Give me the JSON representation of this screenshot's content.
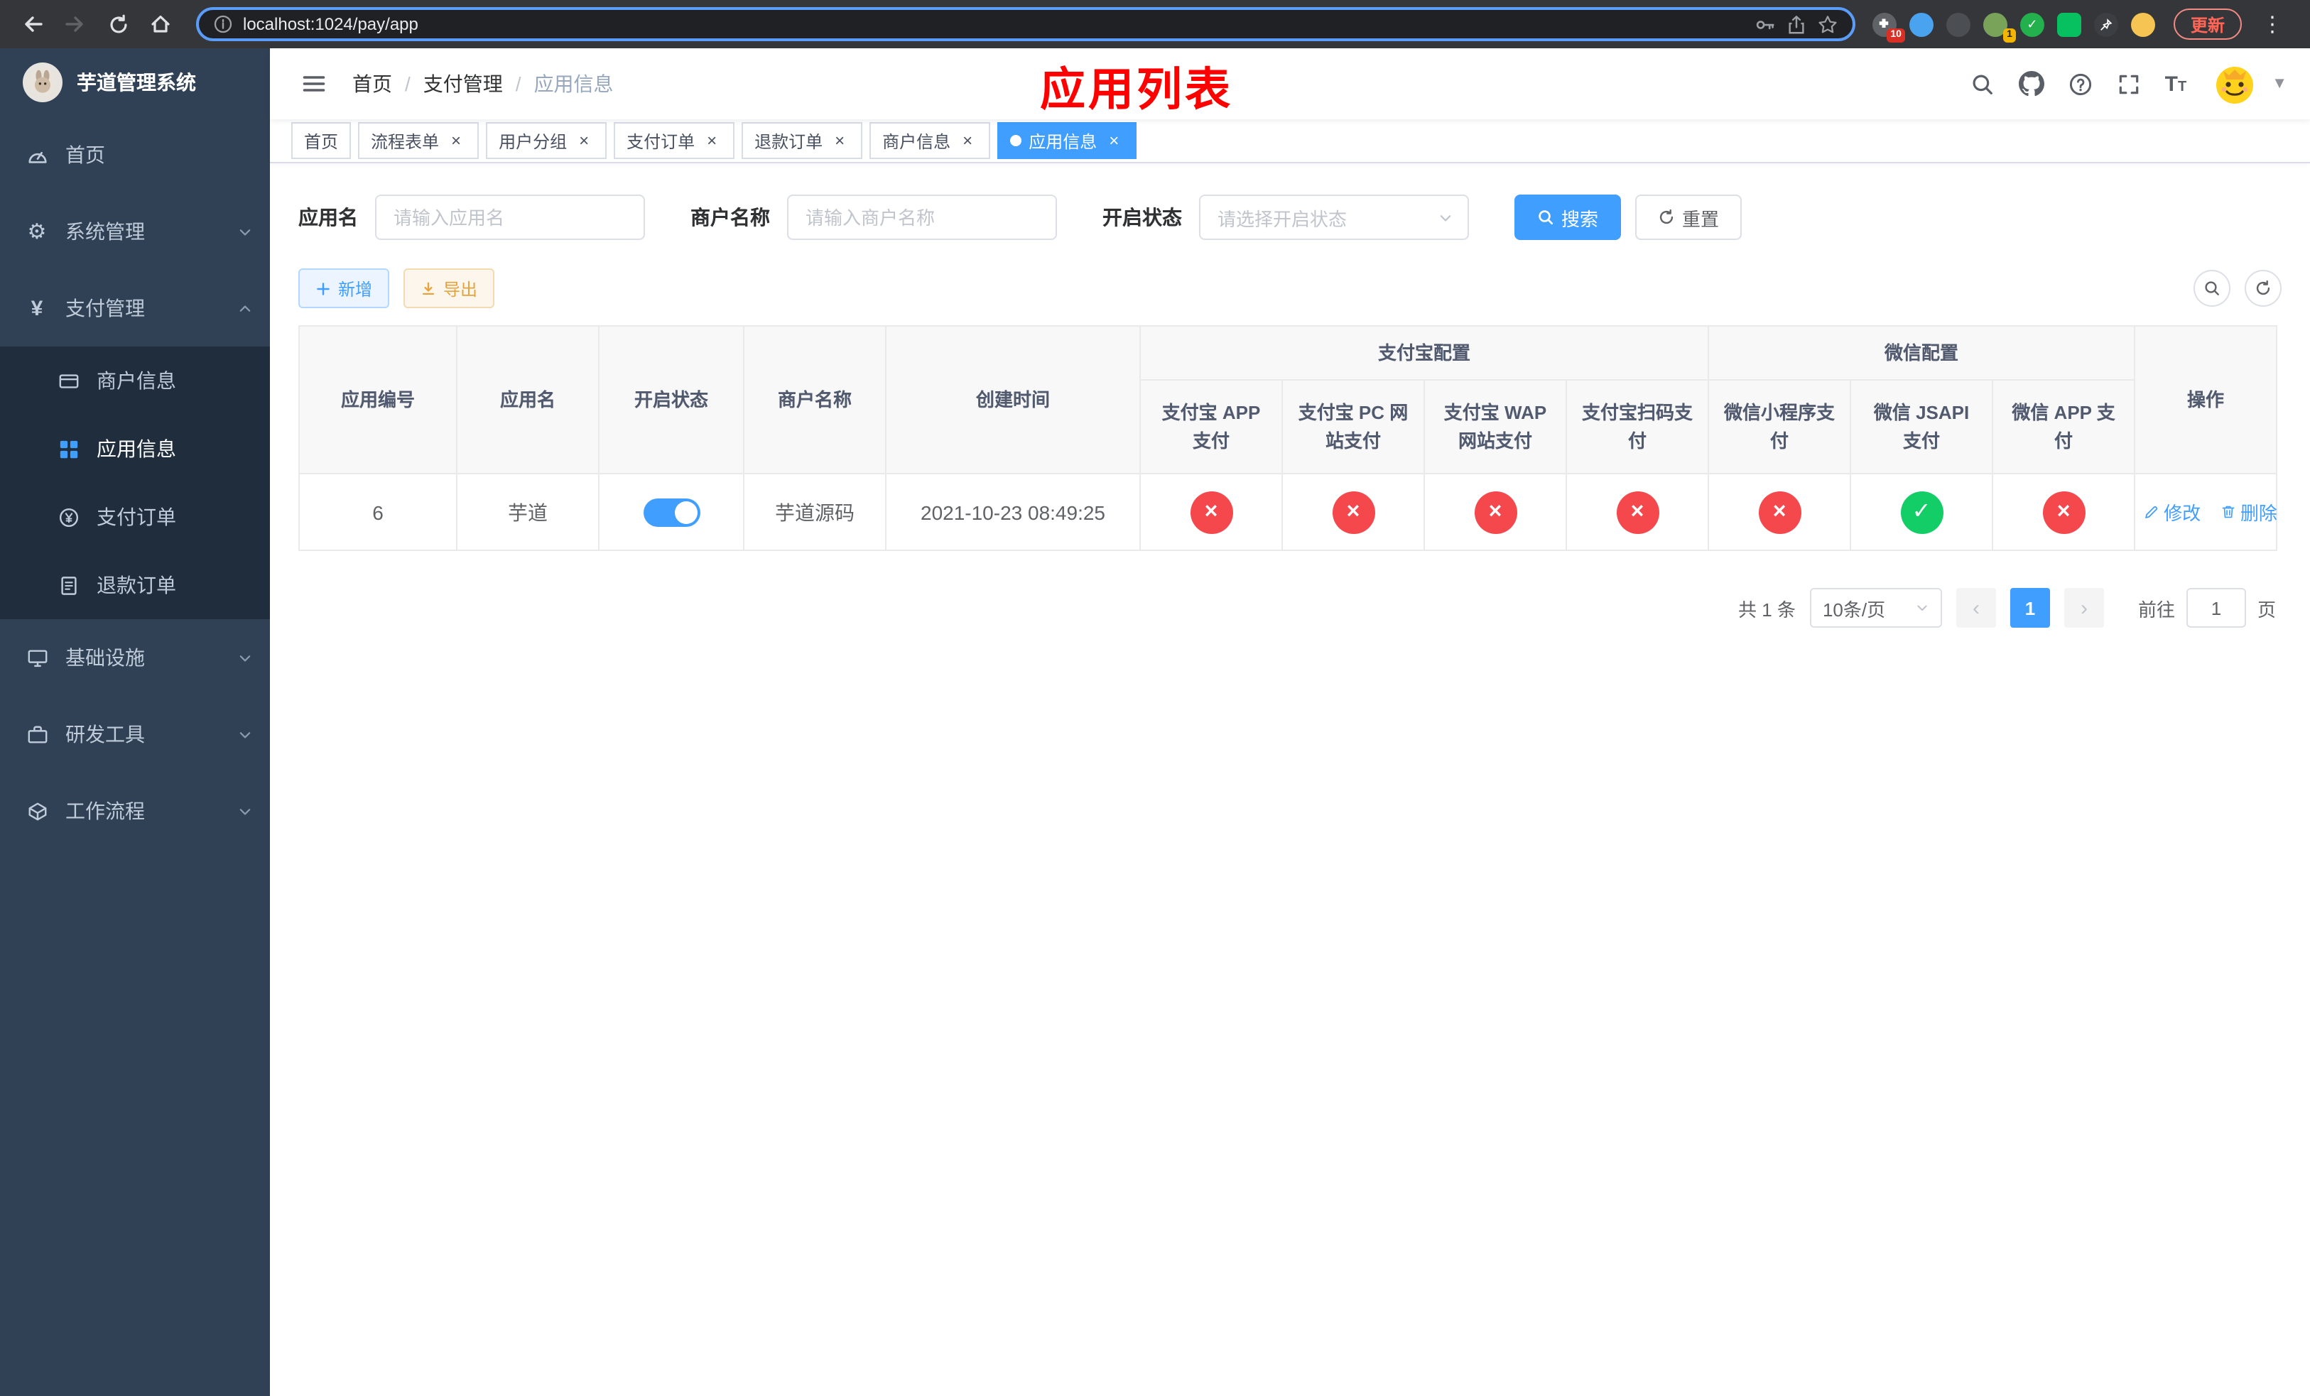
{
  "colors": {
    "accent": "#409eff",
    "danger": "#f5484d",
    "success": "#13ce66",
    "title_red": "#ff0000",
    "warning": "#e6a23c",
    "sidebar_bg": "#304156",
    "submenu_bg": "#1f2d3d"
  },
  "browser": {
    "url": "localhost:1024/pay/app",
    "update_label": "更新",
    "extension_badge_1": "10",
    "extension_badge_2": "1"
  },
  "sidebar": {
    "title": "芋道管理系统",
    "menu": [
      {
        "label": "首页"
      },
      {
        "label": "系统管理"
      },
      {
        "label": "支付管理"
      },
      {
        "label": "基础设施"
      },
      {
        "label": "研发工具"
      },
      {
        "label": "工作流程"
      }
    ],
    "submenu_pay": [
      {
        "label": "商户信息"
      },
      {
        "label": "应用信息"
      },
      {
        "label": "支付订单"
      },
      {
        "label": "退款订单"
      }
    ]
  },
  "header": {
    "breadcrumb": [
      "首页",
      "支付管理",
      "应用信息"
    ],
    "page_title": "应用列表"
  },
  "tabs": [
    {
      "label": "首页"
    },
    {
      "label": "流程表单"
    },
    {
      "label": "用户分组"
    },
    {
      "label": "支付订单"
    },
    {
      "label": "退款订单"
    },
    {
      "label": "商户信息"
    },
    {
      "label": "应用信息"
    }
  ],
  "filters": {
    "app_name_label": "应用名",
    "app_name_placeholder": "请输入应用名",
    "merchant_label": "商户名称",
    "merchant_placeholder": "请输入商户名称",
    "status_label": "开启状态",
    "status_placeholder": "请选择开启状态",
    "search_button": "搜索",
    "reset_button": "重置"
  },
  "toolbar": {
    "add_button": "新增",
    "export_button": "导出"
  },
  "table": {
    "columns": [
      "应用编号",
      "应用名",
      "开启状态",
      "商户名称",
      "创建时间"
    ],
    "groups": [
      {
        "label": "支付宝配置",
        "columns": [
          "支付宝 APP 支付",
          "支付宝 PC 网站支付",
          "支付宝 WAP 网站支付",
          "支付宝扫码支付"
        ]
      },
      {
        "label": "微信配置",
        "columns": [
          "微信小程序支付",
          "微信 JSAPI 支付",
          "微信 APP 支付"
        ]
      }
    ],
    "action_column": "操作",
    "rows": [
      {
        "id": "6",
        "name": "芋道",
        "enabled": true,
        "merchant": "芋道源码",
        "created_at": "2021-10-23 08:49:25",
        "alipay_app": false,
        "alipay_pc": false,
        "alipay_wap": false,
        "alipay_qr": false,
        "wechat_lite": false,
        "wechat_jsapi": true,
        "wechat_app": false,
        "edit_label": "修改",
        "delete_label": "删除"
      }
    ]
  },
  "pagination": {
    "total_text": "共 1 条",
    "page_size": "10条/页",
    "current_page": "1",
    "goto_label": "前往",
    "goto_value": "1",
    "unit_label": "页"
  }
}
